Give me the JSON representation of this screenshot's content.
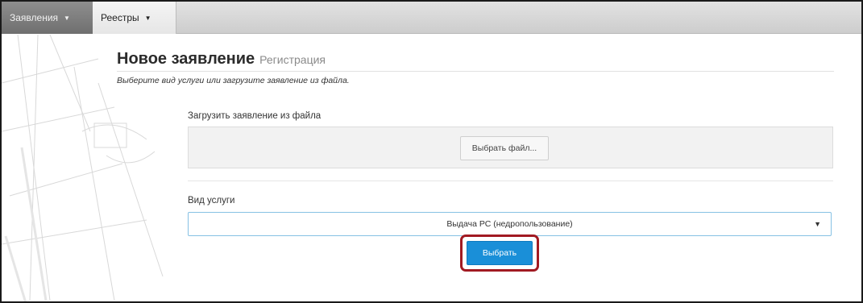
{
  "nav": {
    "items": [
      {
        "label": "Заявления",
        "active": true
      },
      {
        "label": "Реестры",
        "active": false
      }
    ],
    "caret_glyph": "▼"
  },
  "page": {
    "title": "Новое заявление",
    "subtitle": "Регистрация",
    "instruction": "Выберите вид услуги или загрузите заявление из файла."
  },
  "upload": {
    "label": "Загрузить заявление из файла",
    "button_label": "Выбрать файл..."
  },
  "service": {
    "label": "Вид услуги",
    "selected": "Выдача РС (недропользование)",
    "caret_glyph": "▼"
  },
  "submit": {
    "label": "Выбрать"
  },
  "colors": {
    "primary_button": "#1a8fd8",
    "highlight_border": "#a11a22",
    "select_border": "#86c1e4"
  }
}
